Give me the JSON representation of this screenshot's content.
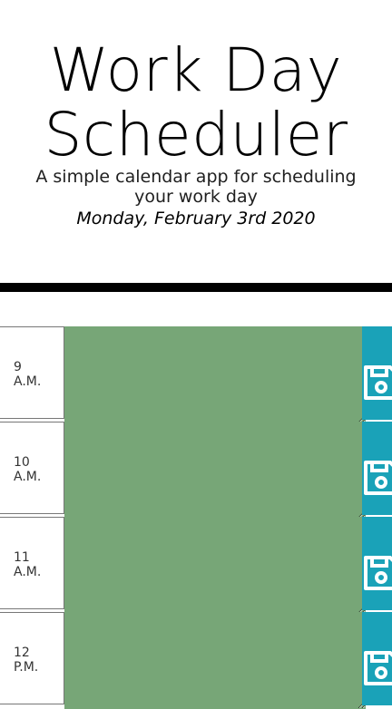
{
  "header": {
    "title_line1": "Work Day",
    "title_line2": "Scheduler",
    "subtitle": "A simple calendar app for scheduling your work day",
    "date": "Monday, February 3rd 2020"
  },
  "schedule": {
    "rows": [
      {
        "hour": "9",
        "period": "A.M.",
        "note": ""
      },
      {
        "hour": "10",
        "period": "A.M.",
        "note": ""
      },
      {
        "hour": "11",
        "period": "A.M.",
        "note": ""
      },
      {
        "hour": "12",
        "period": "P.M.",
        "note": ""
      }
    ],
    "colors": {
      "future": "#77a677",
      "save_button": "#1aa2b8"
    },
    "save_icon": "floppy-disk-icon"
  }
}
